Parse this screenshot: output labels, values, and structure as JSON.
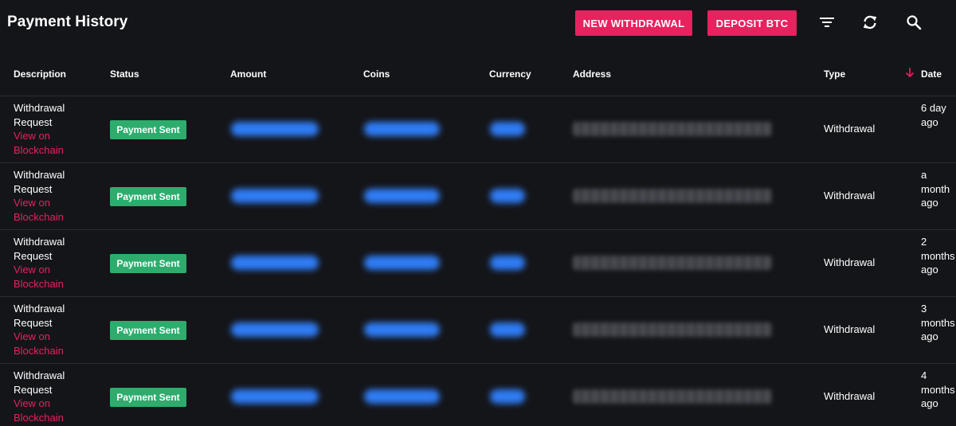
{
  "header": {
    "title": "Payment History",
    "new_withdrawal_label": "NEW WITHDRAWAL",
    "deposit_label": "DEPOSIT BTC",
    "icons": [
      "filter-icon",
      "refresh-icon",
      "search-icon"
    ]
  },
  "table": {
    "columns": {
      "description": "Description",
      "status": "Status",
      "amount": "Amount",
      "coins": "Coins",
      "currency": "Currency",
      "address": "Address",
      "type": "Type",
      "date": "Date"
    },
    "sort": {
      "column": "date",
      "direction": "desc"
    },
    "rows": [
      {
        "desc_1": "Withdrawal",
        "desc_2": "Request",
        "link_1": "View on",
        "link_2": "Blockchain",
        "status": "Payment Sent",
        "type": "Withdrawal",
        "date_1": "6 day",
        "date_2": "ago",
        "date_3": ""
      },
      {
        "desc_1": "Withdrawal",
        "desc_2": "Request",
        "link_1": "View on",
        "link_2": "Blockchain",
        "status": "Payment Sent",
        "type": "Withdrawal",
        "date_1": "a",
        "date_2": "month",
        "date_3": "ago"
      },
      {
        "desc_1": "Withdrawal",
        "desc_2": "Request",
        "link_1": "View on",
        "link_2": "Blockchain",
        "status": "Payment Sent",
        "type": "Withdrawal",
        "date_1": "2",
        "date_2": "months",
        "date_3": "ago"
      },
      {
        "desc_1": "Withdrawal",
        "desc_2": "Request",
        "link_1": "View on",
        "link_2": "Blockchain",
        "status": "Payment Sent",
        "type": "Withdrawal",
        "date_1": "3",
        "date_2": "months",
        "date_3": "ago"
      },
      {
        "desc_1": "Withdrawal",
        "desc_2": "Request",
        "link_1": "View on",
        "link_2": "Blockchain",
        "status": "Payment Sent",
        "type": "Withdrawal",
        "date_1": "4",
        "date_2": "months",
        "date_3": "ago"
      }
    ]
  },
  "colors": {
    "background": "#141519",
    "accent": "#e8215f",
    "status_success": "#2eac6d",
    "redacted_blue": "#2f7cf5"
  }
}
